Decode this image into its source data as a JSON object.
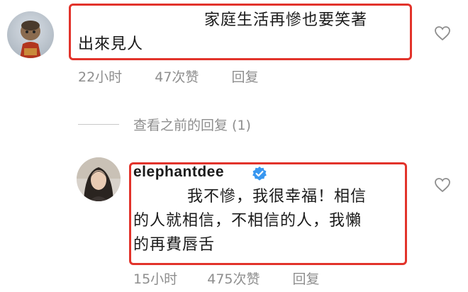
{
  "comment": {
    "text_line1": "家庭生活再慘也要笑著",
    "text_line2": "出來見人",
    "time": "22小时",
    "likes": "47次赞",
    "reply_label": "回复"
  },
  "view_previous": {
    "label": "查看之前的回复 (1)"
  },
  "reply": {
    "username": "elephantdee",
    "verified": true,
    "text_line1": "我不慘，我很幸福！相信",
    "text_line2": "的人就相信，不相信的人，我懶",
    "text_line3": "的再費唇舌",
    "time": "15小时",
    "likes": "475次赞",
    "reply_label": "回复"
  },
  "colors": {
    "highlight": "#e2332b",
    "meta_text": "#8e8e8e",
    "verified": "#3897f0"
  },
  "icons": [
    "heart-outline-icon",
    "verified-badge-icon"
  ]
}
